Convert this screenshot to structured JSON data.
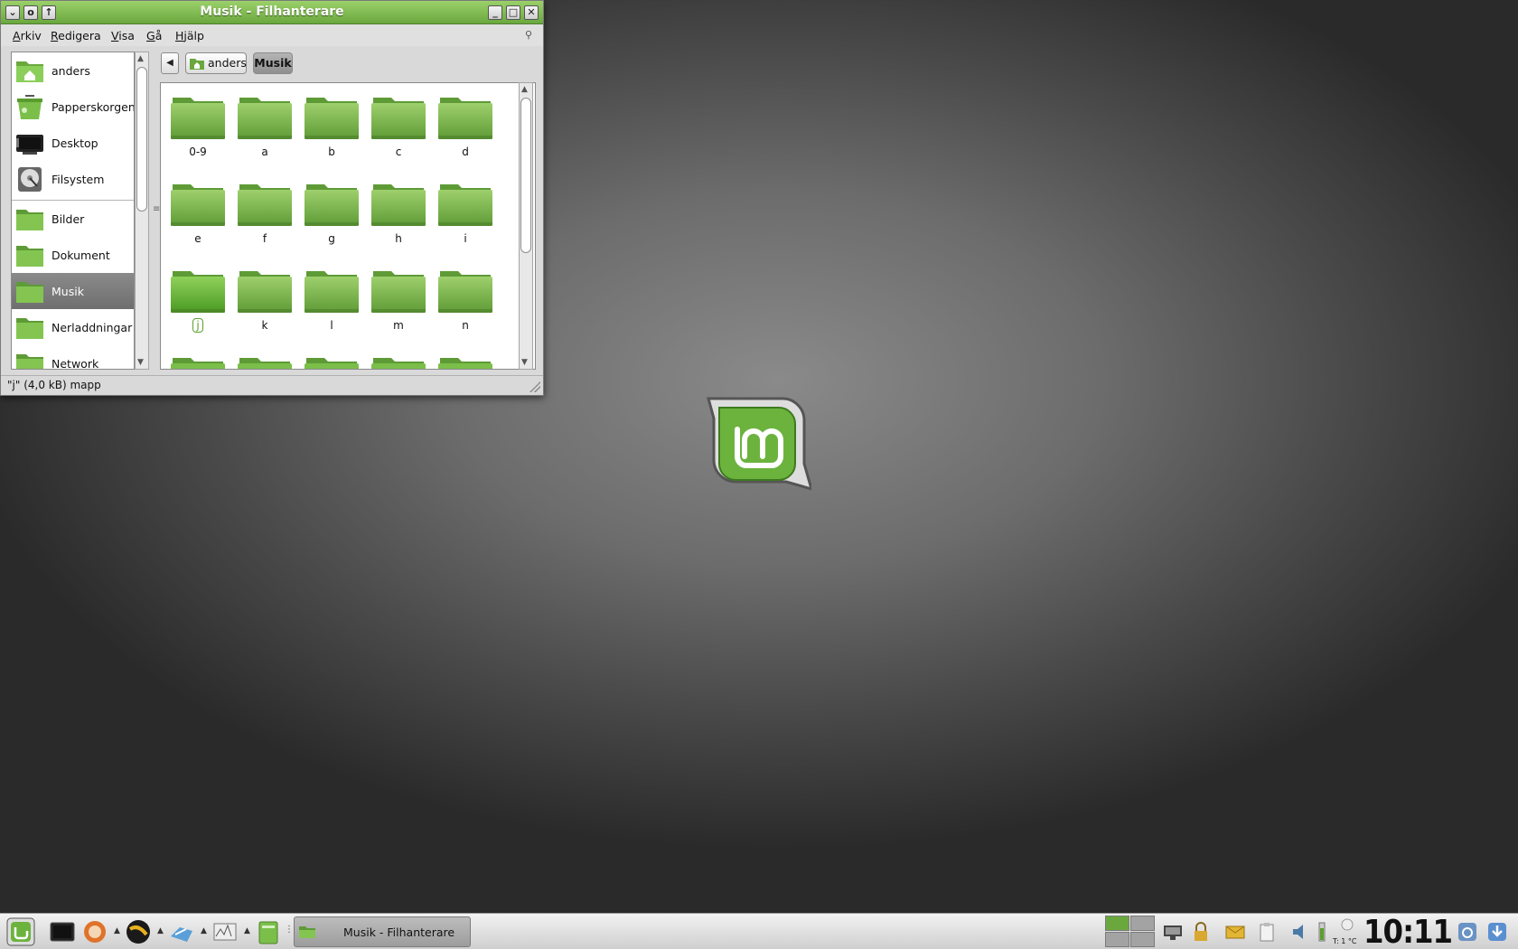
{
  "window": {
    "title": "Musik - Filhanterare",
    "buttons": {
      "menu": "⌄",
      "sticky": "o",
      "shade": "↑",
      "minimize": "_",
      "maximize": "□",
      "close": "✕"
    }
  },
  "menubar": {
    "items": [
      "Arkiv",
      "Redigera",
      "Visa",
      "Gå",
      "Hjälp"
    ]
  },
  "sidepane": {
    "items": [
      {
        "label": "anders",
        "icon": "home-folder-icon"
      },
      {
        "label": "Papperskorgen",
        "icon": "trash-icon"
      },
      {
        "label": "Desktop",
        "icon": "desktop-icon"
      },
      {
        "label": "Filsystem",
        "icon": "harddisk-icon"
      },
      {
        "label": "Bilder",
        "icon": "folder-icon"
      },
      {
        "label": "Dokument",
        "icon": "folder-icon"
      },
      {
        "label": "Musik",
        "icon": "folder-icon",
        "selected": true
      },
      {
        "label": "Nerladdningar",
        "icon": "folder-icon"
      },
      {
        "label": "Network",
        "icon": "folder-icon"
      }
    ]
  },
  "pathbar": {
    "crumbs": [
      "anders",
      "Musik"
    ],
    "active": "Musik"
  },
  "folders": [
    "0-9",
    "a",
    "b",
    "c",
    "d",
    "e",
    "f",
    "g",
    "h",
    "i",
    "j",
    "k",
    "l",
    "m",
    "n"
  ],
  "selected_folder": "j",
  "statusbar": {
    "text": "\"j\" (4,0 kB) mapp"
  },
  "taskbar": {
    "task_label": "Musik - Filhanterare",
    "clock": "10:11",
    "weather": "T: 1 °C"
  },
  "colors": {
    "accent_green": "#6aa83e",
    "folder_green": "#7bbf4a",
    "selection_gray": "#7a7a7a"
  }
}
